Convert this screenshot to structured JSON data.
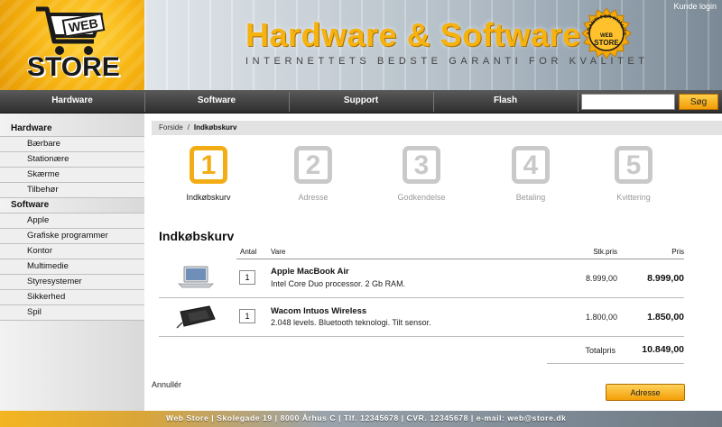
{
  "header": {
    "logo_web": "WEB",
    "logo_store": "STORE",
    "title": "Hardware & Software",
    "tagline": "INTERNETTETS BEDSTE GARANTI FOR KVALITET",
    "badge_text": "GARANTI FOR KVALITET",
    "badge_logo_web": "WEB",
    "badge_logo_store": "STORE",
    "login_link": "Kunde login"
  },
  "nav": {
    "items": [
      "Hardware",
      "Software",
      "Support",
      "Flash"
    ],
    "search_placeholder": "",
    "search_button": "Søg"
  },
  "sidebar": {
    "items": [
      {
        "label": "Hardware",
        "type": "category"
      },
      {
        "label": "Bærbare",
        "type": "sub"
      },
      {
        "label": "Stationære",
        "type": "sub"
      },
      {
        "label": "Skærme",
        "type": "sub"
      },
      {
        "label": "Tilbehør",
        "type": "sub"
      },
      {
        "label": "Software",
        "type": "category"
      },
      {
        "label": "Apple",
        "type": "sub"
      },
      {
        "label": "Grafiske programmer",
        "type": "sub"
      },
      {
        "label": "Kontor",
        "type": "sub"
      },
      {
        "label": "Multimedie",
        "type": "sub"
      },
      {
        "label": "Styresystemer",
        "type": "sub"
      },
      {
        "label": "Sikkerhed",
        "type": "sub"
      },
      {
        "label": "Spil",
        "type": "sub"
      }
    ]
  },
  "breadcrumb": {
    "home": "Forside",
    "separator": "/",
    "current": "Indkøbskurv"
  },
  "steps": [
    {
      "number": "1",
      "label": "Indkøbskurv",
      "active": true
    },
    {
      "number": "2",
      "label": "Adresse",
      "active": false
    },
    {
      "number": "3",
      "label": "Godkendelse",
      "active": false
    },
    {
      "number": "4",
      "label": "Betaling",
      "active": false
    },
    {
      "number": "5",
      "label": "Kvittering",
      "active": false
    }
  ],
  "cart": {
    "heading": "Indkøbskurv",
    "columns": {
      "qty": "Antal",
      "item": "Vare",
      "unit_price": "Stk.pris",
      "price": "Pris"
    },
    "rows": [
      {
        "qty": "1",
        "name": "Apple MacBook Air",
        "desc": "Intel Core Duo processor. 2 Gb RAM.",
        "unit_price": "8.999,00",
        "price": "8.999,00",
        "icon": "laptop-icon"
      },
      {
        "qty": "1",
        "name": "Wacom Intuos Wireless",
        "desc": "2.048 levels. Bluetooth teknologi. Tilt sensor.",
        "unit_price": "1.800,00",
        "price": "1.850,00",
        "icon": "tablet-icon"
      }
    ],
    "total_label": "Totalpris",
    "total_value": "10.849,00",
    "cancel_link": "Annullér",
    "next_button": "Adresse"
  },
  "footer": {
    "text": "Web Store | Skolegade 19 | 8000 Århus C | Tlf. 12345678 | CVR. 12345678 | e-mail: web@store.dk"
  },
  "colors": {
    "accent": "#f3ad14",
    "nav_bg": "#3a3a3a",
    "inactive_step": "#c9c9c9"
  }
}
